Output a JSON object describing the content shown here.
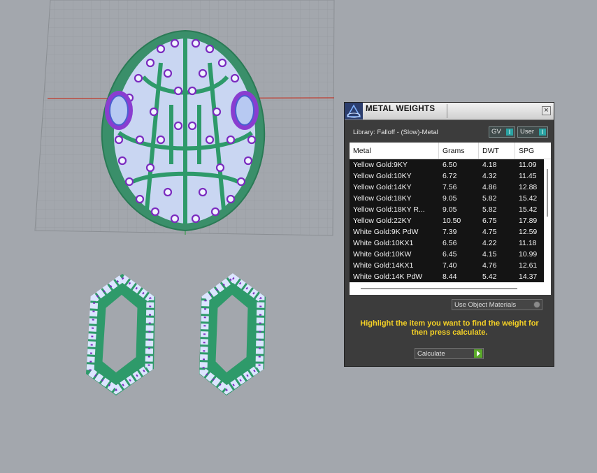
{
  "viewport": {
    "colors": {
      "background": "#a3a7ad",
      "grid": "#8e9297",
      "frame_green": "#2f9e68",
      "stone_light": "#dce6ff",
      "prong_purple": "#7b2bbf",
      "x_axis": "#c0392b",
      "y_axis": "#3aa04a"
    }
  },
  "panel": {
    "title": "METAL WEIGHTS",
    "close_icon": "×",
    "library_label": "Library: Falloff - (Slow)-Metal",
    "toggles": {
      "gv": "GV",
      "user": "User",
      "switch_glyph": "I"
    },
    "columns": [
      "Metal",
      "Grams",
      "DWT",
      "SPG"
    ],
    "rows": [
      {
        "metal": "Yellow Gold:9KY",
        "grams": "6.50",
        "dwt": "4.18",
        "spg": "11.09"
      },
      {
        "metal": "Yellow Gold:10KY",
        "grams": "6.72",
        "dwt": "4.32",
        "spg": "11.45"
      },
      {
        "metal": "Yellow Gold:14KY",
        "grams": "7.56",
        "dwt": "4.86",
        "spg": "12.88"
      },
      {
        "metal": "Yellow Gold:18KY",
        "grams": "9.05",
        "dwt": "5.82",
        "spg": "15.42"
      },
      {
        "metal": "Yellow Gold:18KY R...",
        "grams": "9.05",
        "dwt": "5.82",
        "spg": "15.42"
      },
      {
        "metal": "Yellow Gold:22KY",
        "grams": "10.50",
        "dwt": "6.75",
        "spg": "17.89"
      },
      {
        "metal": "White Gold:9K PdW",
        "grams": "7.39",
        "dwt": "4.75",
        "spg": "12.59"
      },
      {
        "metal": "White Gold:10KX1",
        "grams": "6.56",
        "dwt": "4.22",
        "spg": "11.18"
      },
      {
        "metal": "White Gold:10KW",
        "grams": "6.45",
        "dwt": "4.15",
        "spg": "10.99"
      },
      {
        "metal": "White Gold:14KX1",
        "grams": "7.40",
        "dwt": "4.76",
        "spg": "12.61"
      },
      {
        "metal": "White Gold:14K PdW",
        "grams": "8.44",
        "dwt": "5.42",
        "spg": "14.37"
      }
    ],
    "materials_label": "Use Object Materials",
    "instructions": "Highlight the item you want to find the weight for then press calculate.",
    "calculate_label": "Calculate",
    "colors": {
      "panel_bg": "#3c3c3c",
      "row_bg": "#141414",
      "instruction_text": "#f5d126",
      "accent_teal": "#2aa3a3",
      "go_green": "#5aaa2a"
    }
  }
}
